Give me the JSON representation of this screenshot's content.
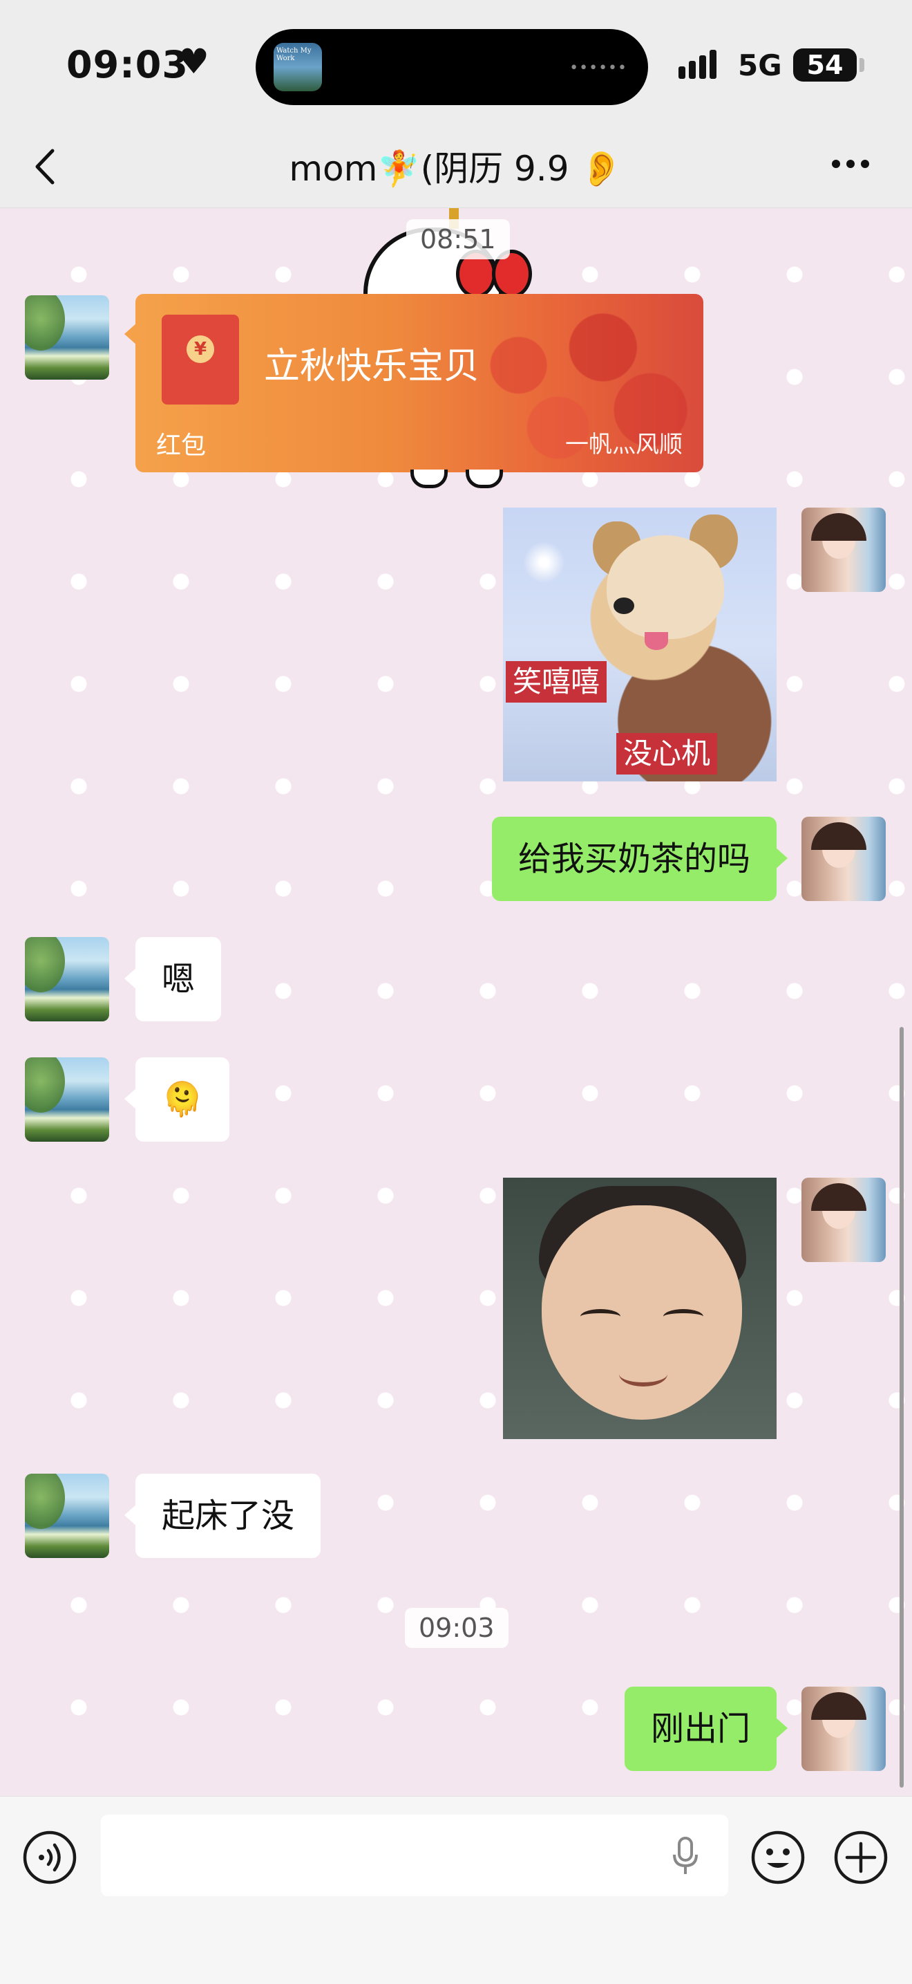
{
  "status_bar": {
    "time": "09:03",
    "heart": "♥",
    "network": "5G",
    "battery": "54",
    "island_app_text": "Watch My Work"
  },
  "nav": {
    "back_icon": "chevron-left-icon",
    "title": "mom🧚(阴历 9.9 👂",
    "more_icon": "more-dots-icon"
  },
  "messages": {
    "timestamp_1": "08:51",
    "red_packet": {
      "title": "立秋快乐宝贝",
      "label": "红包",
      "cover_text": "一帆灬风顺"
    },
    "sticker_dog": {
      "caption_1": "笑嘻嘻",
      "caption_2": "没心机"
    },
    "out_1": "给我买奶茶的吗",
    "in_1": "嗯",
    "in_2": "🫠",
    "in_3": "起床了没",
    "timestamp_2": "09:03",
    "out_2": "刚出门"
  },
  "input_bar": {
    "voice_icon": "voice-icon",
    "emoji_icon": "emoji-icon",
    "plus_icon": "plus-icon",
    "mic_icon": "mic-icon"
  }
}
